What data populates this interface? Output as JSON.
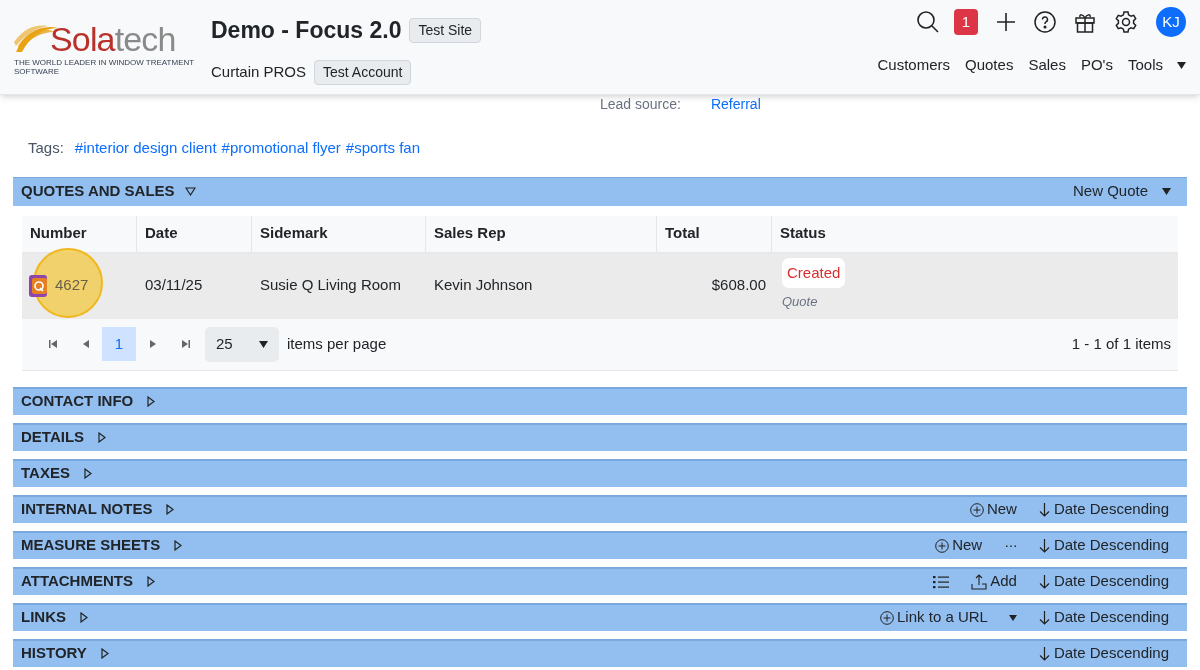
{
  "header": {
    "logo_parts": [
      "Sola",
      "tech"
    ],
    "tagline": "THE WORLD LEADER IN WINDOW TREATMENT SOFTWARE",
    "title": "Demo - Focus 2.0",
    "site_badge": "Test Site",
    "account": "Curtain PROS",
    "account_badge": "Test Account",
    "notification_count": "1",
    "avatar": "KJ",
    "nav": [
      {
        "label": "Customers",
        "dropdown": false
      },
      {
        "label": "Quotes",
        "dropdown": false
      },
      {
        "label": "Sales",
        "dropdown": false
      },
      {
        "label": "PO's",
        "dropdown": false
      },
      {
        "label": "Tools",
        "dropdown": true
      }
    ]
  },
  "lead": {
    "label": "Lead source:",
    "value": "Referral"
  },
  "tags": {
    "label": "Tags:",
    "items": [
      "#interior design client",
      "#promotional flyer",
      "#sports fan"
    ]
  },
  "quotes": {
    "title": "QUOTES AND SALES",
    "expanded": true,
    "action": "New Quote",
    "columns": [
      "Number",
      "Date",
      "Sidemark",
      "Sales Rep",
      "Total",
      "Status"
    ],
    "rows": [
      {
        "number": "4627",
        "date": "03/11/25",
        "sidemark": "Susie Q Living Room",
        "sales_rep": "Kevin Johnson",
        "total": "$608.00",
        "status": "Created",
        "type": "Quote",
        "highlighted": true
      }
    ],
    "pager": {
      "page": "1",
      "page_size": "25",
      "per_page_label": "items per page",
      "summary": "1 - 1 of 1 items"
    }
  },
  "sections": [
    {
      "title": "CONTACT INFO",
      "expanded": false
    },
    {
      "title": "DETAILS",
      "expanded": false
    },
    {
      "title": "TAXES",
      "expanded": false
    },
    {
      "title": "INTERNAL NOTES",
      "expanded": false,
      "actions": [
        {
          "kind": "new",
          "label": "New"
        },
        {
          "kind": "sort",
          "label": "Date Descending"
        }
      ]
    },
    {
      "title": "MEASURE SHEETS",
      "expanded": false,
      "actions": [
        {
          "kind": "new",
          "label": "New"
        },
        {
          "kind": "more",
          "label": "···"
        },
        {
          "kind": "sort",
          "label": "Date Descending"
        }
      ]
    },
    {
      "title": "ATTACHMENTS",
      "expanded": false,
      "actions": [
        {
          "kind": "list"
        },
        {
          "kind": "upload",
          "label": "Add"
        },
        {
          "kind": "sort",
          "label": "Date Descending"
        }
      ]
    },
    {
      "title": "LINKS",
      "expanded": false,
      "actions": [
        {
          "kind": "link",
          "label": "Link to a URL"
        },
        {
          "kind": "sort",
          "label": "Date Descending"
        }
      ]
    },
    {
      "title": "HISTORY",
      "expanded": false,
      "actions": [
        {
          "kind": "sort",
          "label": "Date Descending"
        }
      ]
    }
  ]
}
